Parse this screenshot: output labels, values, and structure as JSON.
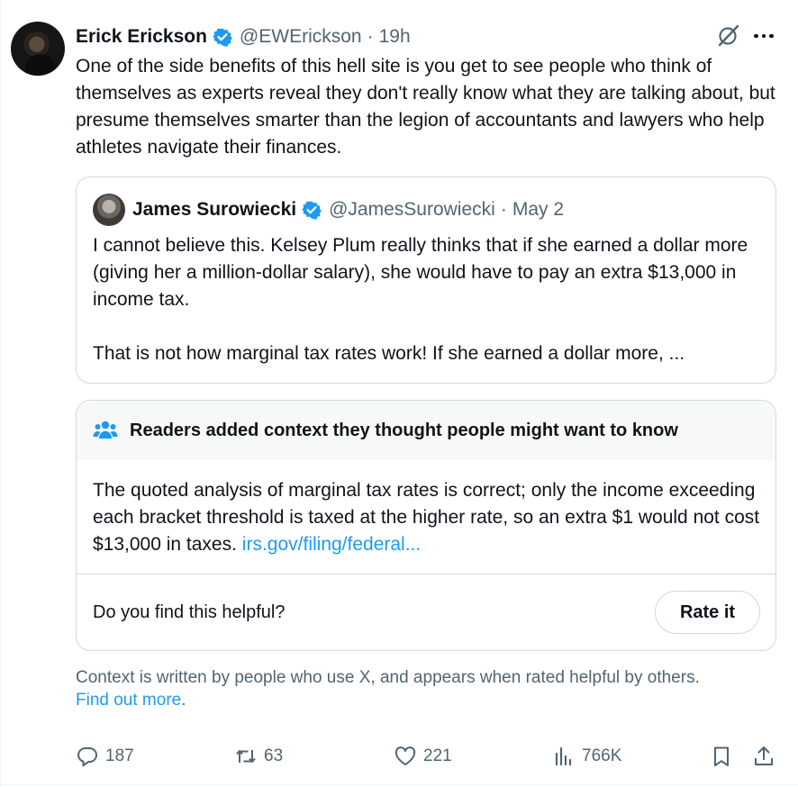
{
  "tweet": {
    "author_name": "Erick Erickson",
    "handle": "@EWErickson",
    "separator": "·",
    "time": "19h",
    "text": "One of the side benefits of this hell site is you get to see people who think of themselves as experts reveal they don't really know what they are talking about, but presume themselves smarter than the legion of accountants and lawyers who help athletes navigate their finances."
  },
  "quote": {
    "author_name": "James Surowiecki",
    "handle": "@JamesSurowiecki",
    "separator": "·",
    "date": "May 2",
    "paragraph1": "I cannot believe this. Kelsey Plum really thinks that if she earned a dollar more (giving her a million-dollar salary), she would have to pay an extra $13,000 in income tax.",
    "paragraph2": "That is not how marginal tax rates work! If she earned a dollar more, ..."
  },
  "community_note": {
    "title": "Readers added context they thought people might want to know",
    "text": "The quoted analysis of marginal tax rates is correct; only the income exceeding each bracket threshold is taxed at the higher rate, so an extra $1 would not cost $13,000 in taxes. ",
    "link_text": "irs.gov/filing/federal...",
    "helpful_question": "Do you find this helpful?",
    "rate_button": "Rate it"
  },
  "context_footer": {
    "text": "Context is written by people who use X, and appears when rated helpful by others.",
    "link_text": "Find out more",
    "trailing": "."
  },
  "actions": {
    "replies": "187",
    "reposts": "63",
    "likes": "221",
    "views": "766K"
  },
  "colors": {
    "accent": "#1d9bf0",
    "text": "#0f1419",
    "secondary": "#536471",
    "border": "#cfd9de"
  },
  "icons": [
    "verified-badge-icon",
    "grok-icon",
    "more-icon",
    "people-icon",
    "reply-icon",
    "repost-icon",
    "like-icon",
    "views-icon",
    "bookmark-icon",
    "share-icon"
  ]
}
